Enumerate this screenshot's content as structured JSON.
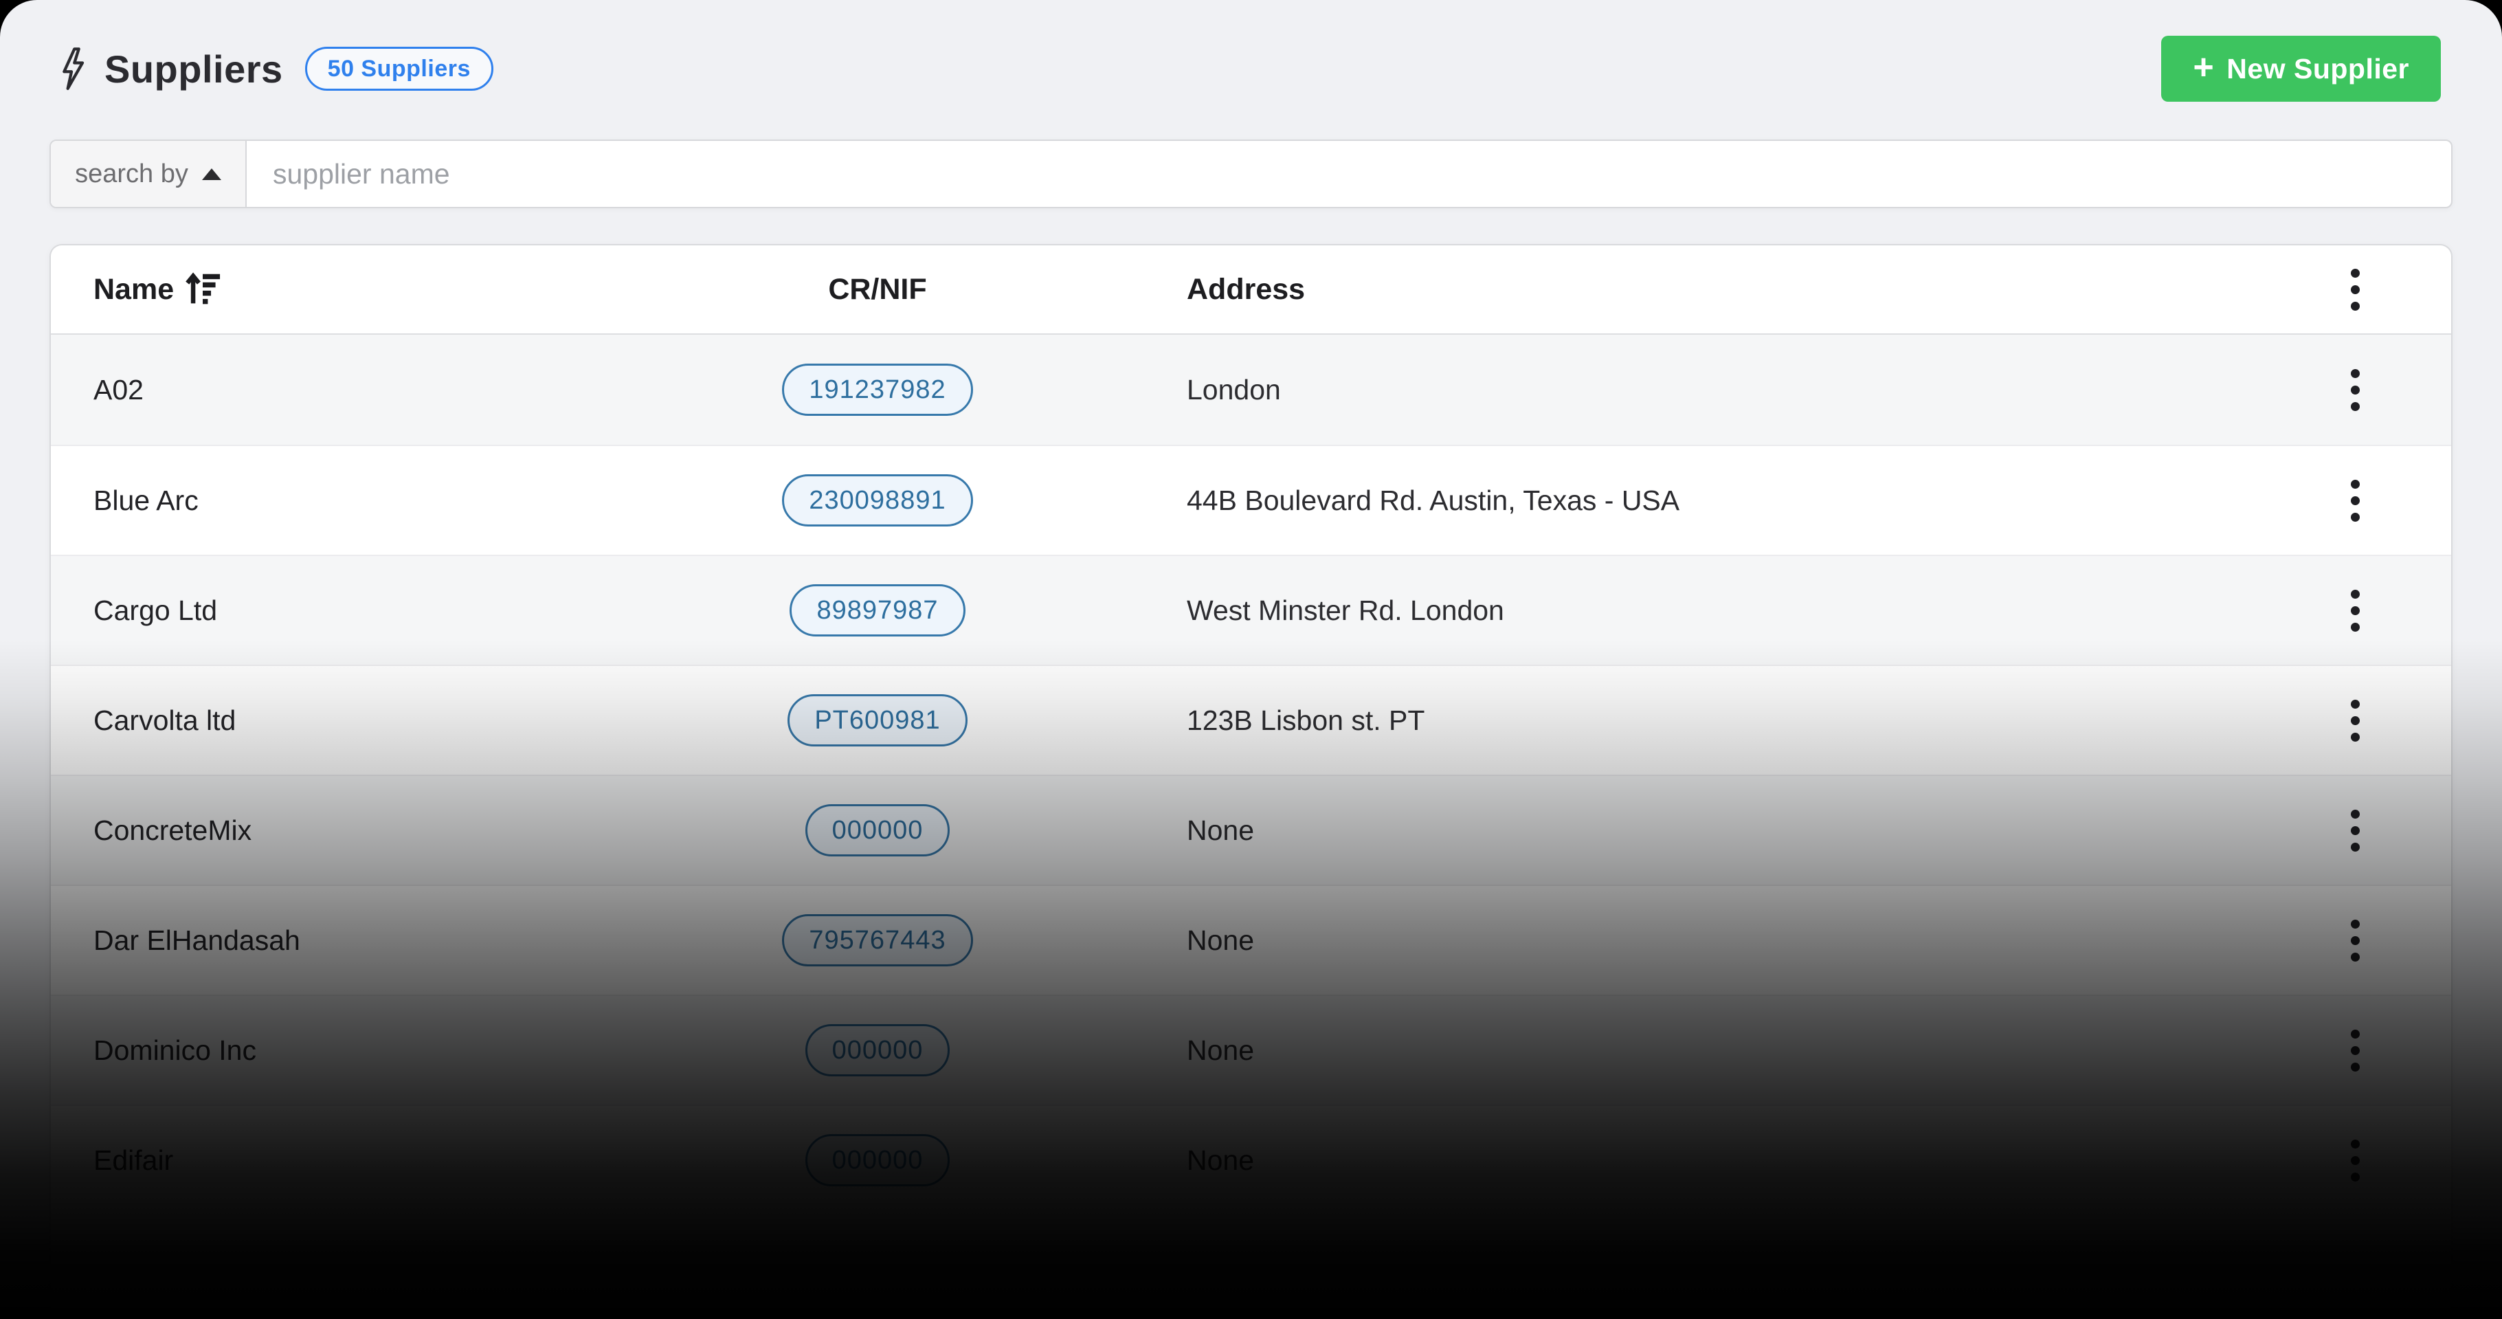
{
  "header": {
    "title": "Suppliers",
    "count_badge": "50 Suppliers",
    "new_supplier_button": "New Supplier",
    "plus_icon": "+"
  },
  "search": {
    "dropdown_label": "search by",
    "placeholder": "supplier name"
  },
  "table": {
    "columns": {
      "name": "Name",
      "cr_nif": "CR/NIF",
      "address": "Address"
    },
    "rows": [
      {
        "name": "A02",
        "cr_nif": "191237982",
        "address": "London"
      },
      {
        "name": "Blue Arc",
        "cr_nif": "230098891",
        "address": "44B Boulevard Rd. Austin, Texas - USA"
      },
      {
        "name": "Cargo Ltd",
        "cr_nif": "89897987",
        "address": "West Minster Rd. London"
      },
      {
        "name": "Carvolta ltd",
        "cr_nif": "PT600981",
        "address": "123B Lisbon st. PT"
      },
      {
        "name": "ConcreteMix",
        "cr_nif": "000000",
        "address": "None"
      },
      {
        "name": "Dar ElHandasah",
        "cr_nif": "795767443",
        "address": "None"
      },
      {
        "name": "Dominico Inc",
        "cr_nif": "000000",
        "address": "None"
      },
      {
        "name": "Edifair",
        "cr_nif": "000000",
        "address": "None"
      }
    ]
  },
  "colors": {
    "accent_blue": "#2f80ed",
    "pill_blue": "#2d6e9e",
    "pill_background": "#eef5fc",
    "button_green": "#3dc45f",
    "page_background": "#f0f1f4"
  }
}
